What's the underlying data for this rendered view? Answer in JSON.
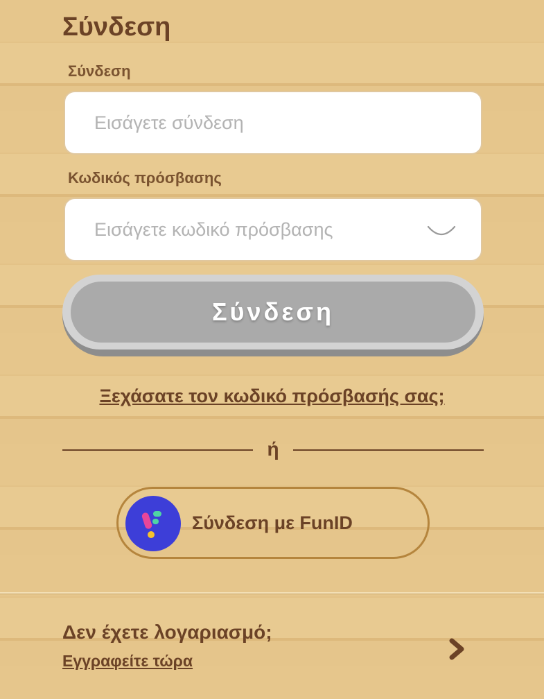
{
  "header": {
    "title": "Σύνδεση"
  },
  "login_field": {
    "label": "Σύνδεση",
    "placeholder": "Εισάγετε σύνδεση",
    "value": ""
  },
  "password_field": {
    "label": "Κωδικός πρόσβασης",
    "placeholder": "Εισάγετε κωδικό πρόσβασης",
    "value": "",
    "toggle_icon": "eye-closed-icon"
  },
  "login_button": {
    "label": "Σύνδεση",
    "state": "disabled"
  },
  "forgot_link": {
    "label": "Ξεχάσατε τον κωδικό πρόσβασής σας;"
  },
  "divider": {
    "label": "ή"
  },
  "funid_button": {
    "label": "Σύνδεση με FunID",
    "icon": "funid-logo-icon"
  },
  "footer": {
    "prompt": "Δεν έχετε λογαριασμό;",
    "register_link": "Εγγραφείτε τώρα",
    "icon": "chevron-right-icon"
  },
  "colors": {
    "text_brown": "#6b4226",
    "background": "#e6c68c",
    "button_disabled": "#aaaaaa",
    "funid_blue": "#3d3ed8"
  }
}
